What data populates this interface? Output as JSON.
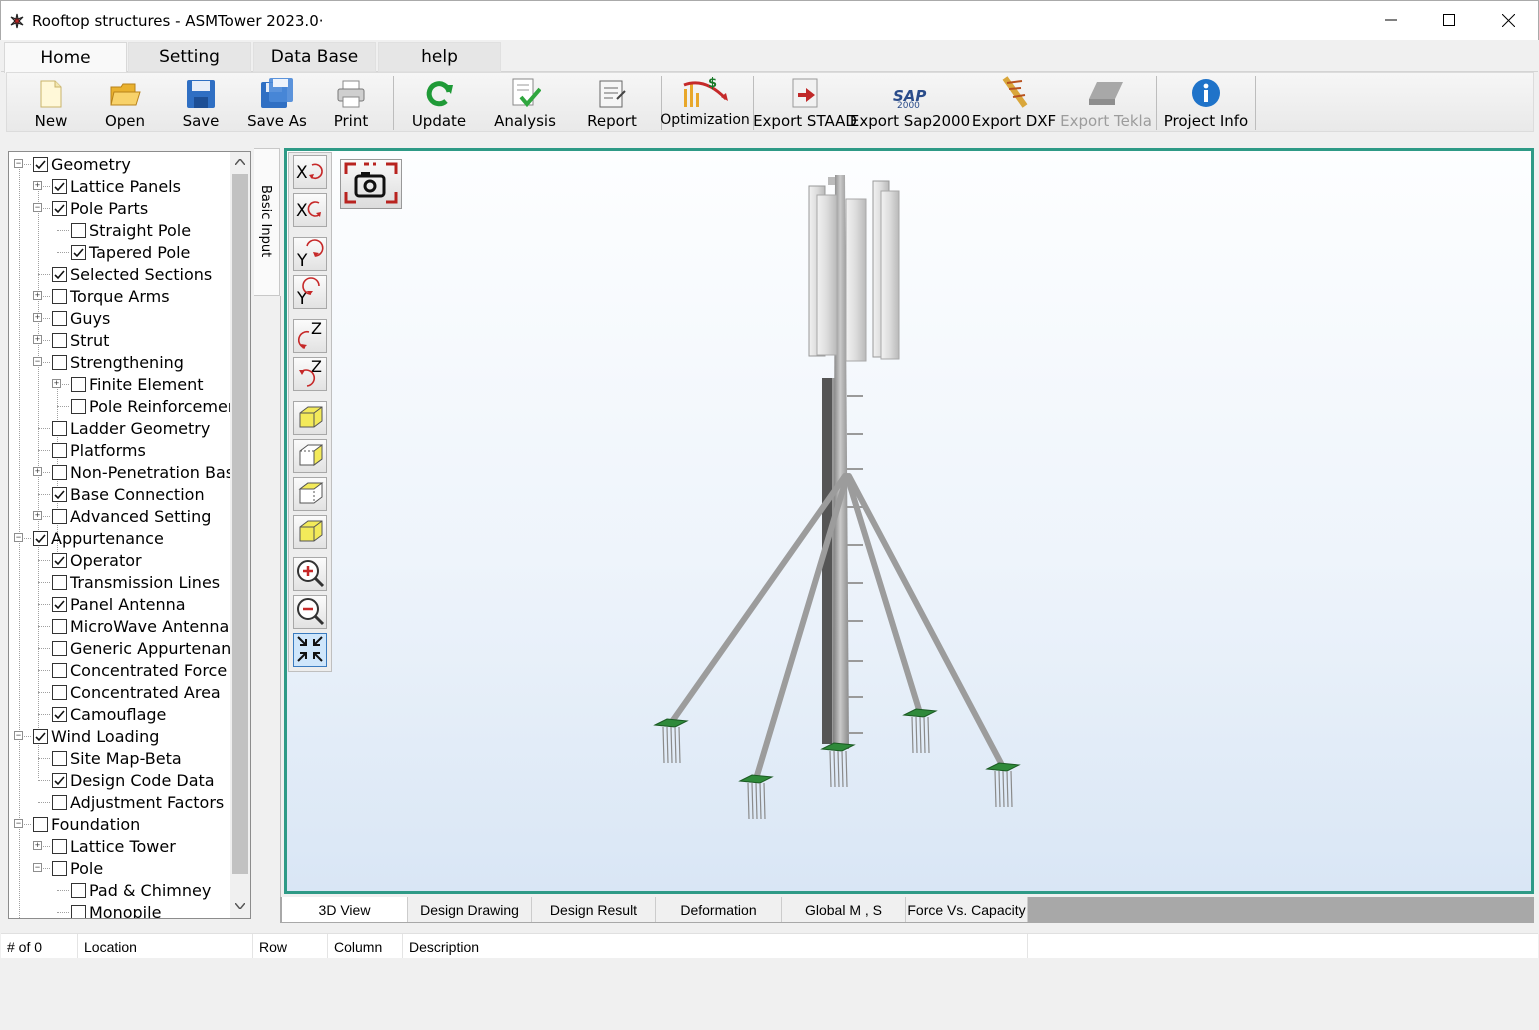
{
  "window": {
    "title": "Rooftop structures - ASMTower 2023.0·"
  },
  "tabs": [
    {
      "label": "Home",
      "active": true
    },
    {
      "label": "Setting",
      "active": false
    },
    {
      "label": "Data Base",
      "active": false
    },
    {
      "label": "help",
      "active": false
    }
  ],
  "ribbon": {
    "new": "New",
    "open": "Open",
    "save": "Save",
    "save_as": "Save As",
    "print": "Print",
    "update": "Update",
    "analysis": "Analysis",
    "report": "Report",
    "optimization": "Optimization",
    "export_staad": "Export STAAD",
    "export_sap": "Export Sap2000",
    "export_dxf": "Export DXF",
    "export_tekla": "Export Tekla",
    "project_info": "Project Info"
  },
  "tree": {
    "items": [
      {
        "label": "Geometry",
        "checked": true
      },
      {
        "label": "Lattice Panels",
        "checked": true
      },
      {
        "label": "Pole Parts",
        "checked": true
      },
      {
        "label": "Straight Pole",
        "checked": false
      },
      {
        "label": "Tapered Pole",
        "checked": true
      },
      {
        "label": "Selected Sections",
        "checked": true
      },
      {
        "label": "Torque Arms",
        "checked": false
      },
      {
        "label": "Guys",
        "checked": false
      },
      {
        "label": "Strut",
        "checked": false
      },
      {
        "label": "Strengthening",
        "checked": false
      },
      {
        "label": "Finite Element",
        "checked": false
      },
      {
        "label": "Pole Reinforcement",
        "checked": false
      },
      {
        "label": "Ladder Geometry",
        "checked": false
      },
      {
        "label": "Platforms",
        "checked": false
      },
      {
        "label": "Non-Penetration Base",
        "checked": false
      },
      {
        "label": "Base Connection",
        "checked": true
      },
      {
        "label": "Advanced Setting",
        "checked": false
      },
      {
        "label": "Appurtenance",
        "checked": true
      },
      {
        "label": "Operator",
        "checked": true
      },
      {
        "label": "Transmission Lines",
        "checked": false
      },
      {
        "label": "Panel Antenna",
        "checked": true
      },
      {
        "label": "MicroWave Antenna",
        "checked": false
      },
      {
        "label": "Generic Appurtenance",
        "checked": false
      },
      {
        "label": "Concentrated Force",
        "checked": false
      },
      {
        "label": "Concentrated Area",
        "checked": false
      },
      {
        "label": "Camouflage",
        "checked": true
      },
      {
        "label": "Wind Loading",
        "checked": true
      },
      {
        "label": "Site Map-Beta",
        "checked": false
      },
      {
        "label": "Design Code Data",
        "checked": true
      },
      {
        "label": "Adjustment Factors",
        "checked": false
      },
      {
        "label": "Foundation",
        "checked": false
      },
      {
        "label": "Lattice Tower",
        "checked": false
      },
      {
        "label": "Pole",
        "checked": false
      },
      {
        "label": "Pad & Chimney",
        "checked": false
      },
      {
        "label": "Monopile",
        "checked": false
      }
    ]
  },
  "side_tab": "Basic Input",
  "view_tabs": [
    {
      "label": "3D View",
      "active": true
    },
    {
      "label": "Design Drawing",
      "active": false
    },
    {
      "label": "Design Result",
      "active": false
    },
    {
      "label": "Deformation",
      "active": false
    },
    {
      "label": "Global M , S",
      "active": false
    },
    {
      "label": "Force Vs. Capacity",
      "active": false
    }
  ],
  "results_grid": {
    "count": "# of 0",
    "location": "Location",
    "row": "Row",
    "column": "Column",
    "description": "Description"
  },
  "colors": {
    "viewport_border": "#2e9a86",
    "pole_gray": "#9a9a9a",
    "base_plate_green": "#2f8a3a"
  }
}
